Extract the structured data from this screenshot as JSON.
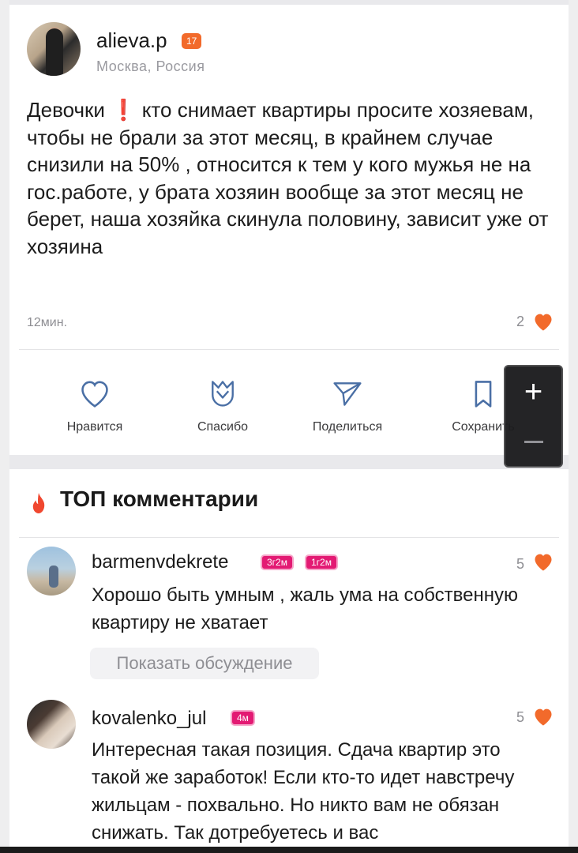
{
  "post": {
    "username": "alieva.p",
    "badge": "17",
    "location": "Москва, Россия",
    "text_part1": "Девочки",
    "text_part2": " кто снимает квартиры просите хозяевам, чтобы не брали за этот месяц, в крайнем случае снизили на 50% , относится к тем у кого мужья не на гос.работе, у брата хозяин вообще за этот месяц не берет, наша хозяйка скинула половину, зависит уже от хозяина",
    "exclamation": "❗",
    "time": "12мин.",
    "likes": "2"
  },
  "actions": [
    {
      "label": "Нравится",
      "icon": "heart-outline-icon"
    },
    {
      "label": "Спасибо",
      "icon": "tulip-icon"
    },
    {
      "label": "Поделиться",
      "icon": "send-icon"
    },
    {
      "label": "Сохранить",
      "icon": "bookmark-icon"
    }
  ],
  "zoom": {
    "plus": "+",
    "minus": "−"
  },
  "comments_section": {
    "title": "ТОП комментарии",
    "icon": "fire-icon"
  },
  "comments": [
    {
      "username": "barmenvdekrete",
      "badges": [
        "3г2м",
        "1г2м"
      ],
      "text": "Хорошо быть умным , жаль ума на собственную квартиру не хватает",
      "likes": "5",
      "discussion_button": "Показать обсуждение"
    },
    {
      "username": "kovalenko_jul",
      "badges": [
        "4м"
      ],
      "text": "Интересная такая позиция. Сдача квартир это такой же заработок! Если кто-то идет навстречу жильцам - похвально. Но никто вам не обязан снижать. Так дотребуетесь и вас",
      "likes": "5"
    }
  ],
  "colors": {
    "accent_heart": "#f26a2b",
    "badge_orange": "#f26a2b",
    "badge_pink": "#e31a73",
    "fire": "#f0472f"
  }
}
